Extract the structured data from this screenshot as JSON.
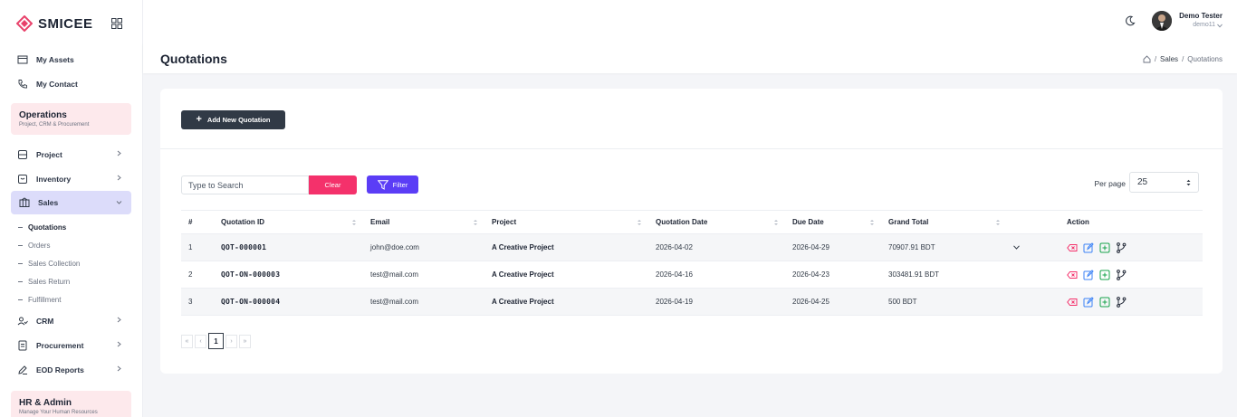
{
  "brand": {
    "name": "SMICEE",
    "accent": "#e8416a"
  },
  "sidebar": {
    "top_items": [
      {
        "label": "My Assets",
        "icon": "wallet-icon"
      },
      {
        "label": "My Contact",
        "icon": "phone-icon"
      }
    ],
    "section_operations": {
      "title": "Operations",
      "subtitle": "Project, CRM & Procurement"
    },
    "items": [
      {
        "label": "Project",
        "icon": "database-icon"
      },
      {
        "label": "Inventory",
        "icon": "box-icon"
      },
      {
        "label": "Sales",
        "icon": "columns-icon"
      }
    ],
    "sales_sub": [
      "Quotations",
      "Orders",
      "Sales Collection",
      "Sales Return",
      "Fulfillment"
    ],
    "items_after": [
      {
        "label": "CRM",
        "icon": "users-icon"
      },
      {
        "label": "Procurement",
        "icon": "document-icon"
      },
      {
        "label": "EOD Reports",
        "icon": "pencil-icon"
      }
    ],
    "section_hr": {
      "title": "HR & Admin",
      "subtitle": "Manage Your Human Resources"
    }
  },
  "user": {
    "name": "Demo Tester",
    "username": "demo11"
  },
  "page": {
    "title": "Quotations"
  },
  "breadcrumb": {
    "level1": "Sales",
    "level2": "Quotations",
    "sep": "/"
  },
  "toolbar": {
    "add_label": "Add New Quotation",
    "search_placeholder": "Type to Search",
    "clear_label": "Clear",
    "filter_label": "Filter",
    "per_page_label": "Per page",
    "per_page_value": "25"
  },
  "table": {
    "headers": [
      "#",
      "Quotation ID",
      "Email",
      "Project",
      "Quotation Date",
      "Due Date",
      "Grand Total",
      "",
      "Action"
    ],
    "rows": [
      {
        "num": "1",
        "id": "QOT-000001",
        "email": "john@doe.com",
        "project": "A Creative Project",
        "qdate": "2026-04-02",
        "due": "2026-04-29",
        "total": "70907.91 BDT"
      },
      {
        "num": "2",
        "id": "QOT-ON-000003",
        "email": "test@mail.com",
        "project": "A Creative Project",
        "qdate": "2026-04-16",
        "due": "2026-04-23",
        "total": "303481.91 BDT"
      },
      {
        "num": "3",
        "id": "QOT-ON-000004",
        "email": "test@mail.com",
        "project": "A Creative Project",
        "qdate": "2026-04-19",
        "due": "2026-04-25",
        "total": "500 BDT"
      }
    ]
  },
  "pagination": {
    "first": "«",
    "prev": "‹",
    "current": "1",
    "next": "›",
    "last": "»"
  },
  "colors": {
    "clear": "#f4316b",
    "filter": "#5b3df6",
    "add": "#313a46",
    "delete": "#f4316b",
    "edit": "#3b82f6",
    "copy": "#16a34a",
    "branch": "#1d2433"
  }
}
